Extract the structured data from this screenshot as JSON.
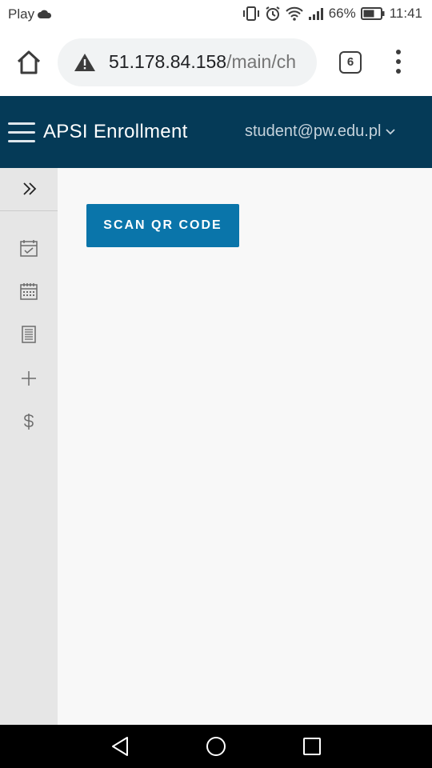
{
  "status_bar": {
    "carrier": "Play",
    "battery": "66%",
    "time": "11:41"
  },
  "browser": {
    "url_host": "51.178.84.158",
    "url_path": "/main/ch",
    "tab_count": "6"
  },
  "header": {
    "title": "APSI Enrollment",
    "user_email": "student@pw.edu.pl"
  },
  "sidebar": {
    "items": [
      {
        "icon": "calendar-check-icon"
      },
      {
        "icon": "calendar-grid-icon"
      },
      {
        "icon": "document-list-icon"
      },
      {
        "icon": "plus-icon"
      },
      {
        "icon": "dollar-icon"
      }
    ]
  },
  "main": {
    "scan_button_label": "SCAN QR CODE"
  },
  "colors": {
    "header_bg": "#053a57",
    "button_bg": "#0a75aa",
    "sidebar_bg": "#e6e6e6"
  }
}
